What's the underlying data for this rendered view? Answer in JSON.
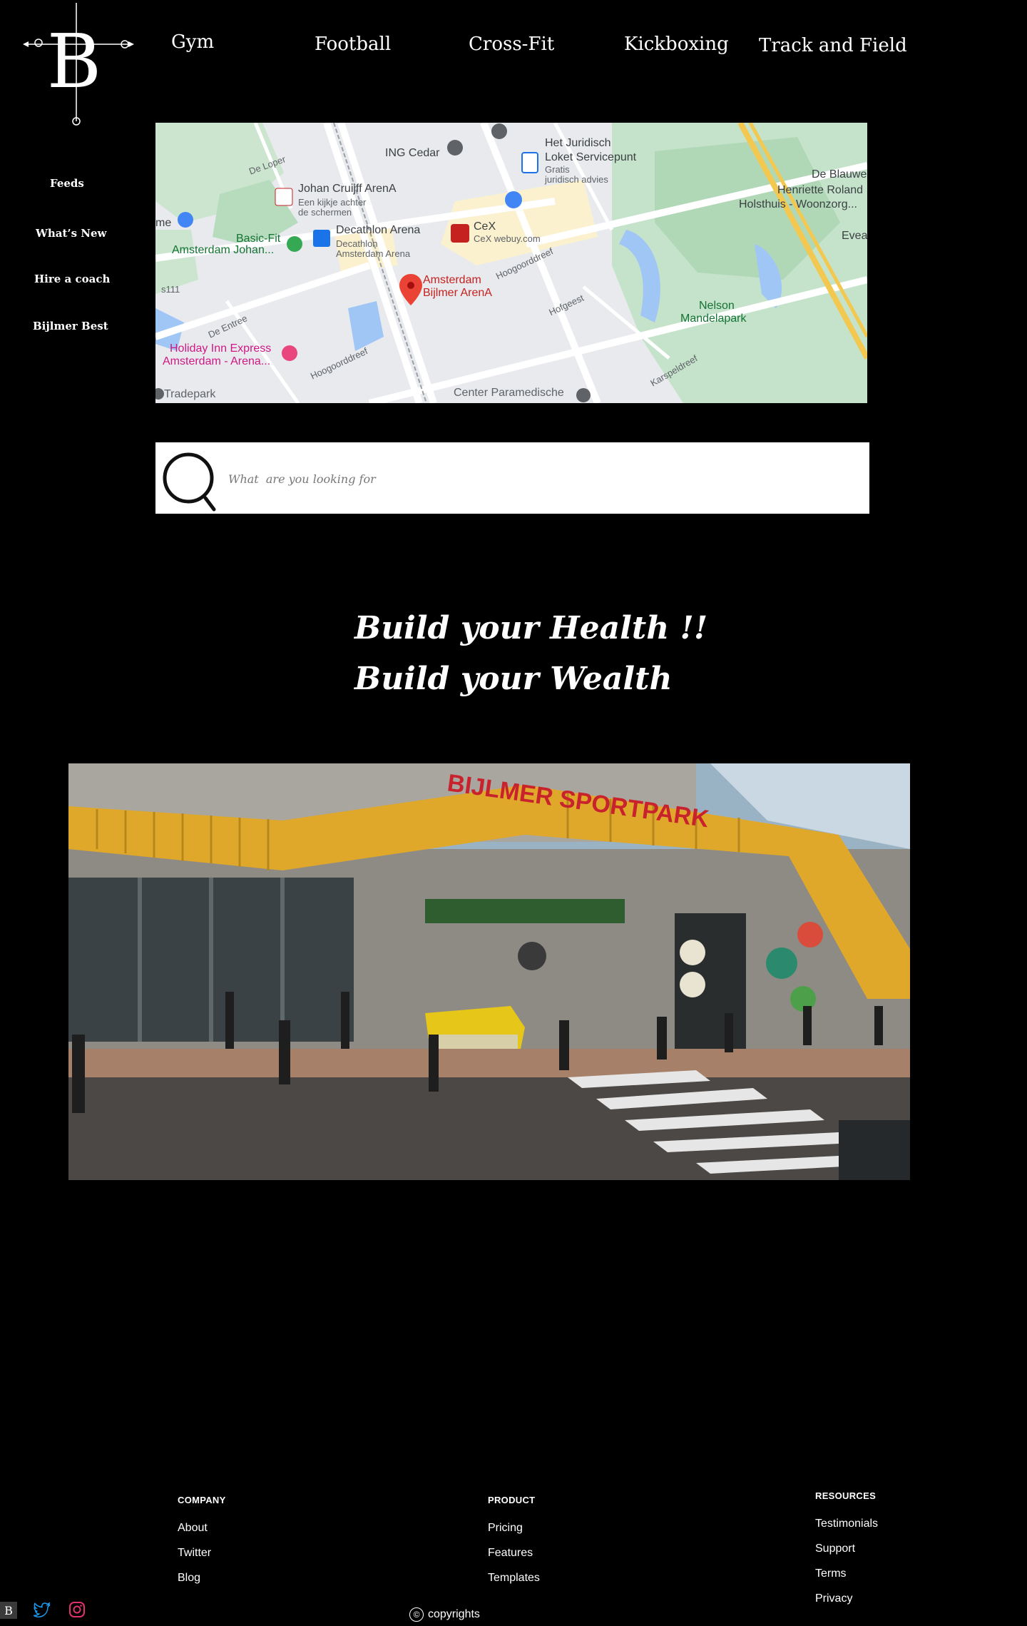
{
  "brand": {
    "logo_letter": "B"
  },
  "top_nav": [
    "Gym",
    "Football",
    "Cross-Fit",
    "Kickboxing",
    "Track and Field"
  ],
  "side_nav": [
    "Feeds",
    "What’s New",
    "Hire a coach",
    "Bijlmer Best"
  ],
  "map": {
    "labels": {
      "ing": "ING Cedar",
      "juridisch1": "Het Juridisch",
      "juridisch2": "Loket Servicepunt",
      "juridisch3": "Gratis",
      "juridisch4": "juridisch advies",
      "blauwe": "De Blauwe",
      "henriette": "Henriette Roland",
      "holsthuis": "Holsthuis - Woonzorg...",
      "evea": "Evea",
      "johan1": "Johan Cruijff ArenA",
      "johan2": "Een kijkje achter",
      "johan3": "de schermen",
      "decathlon1": "Decathlon Arena",
      "decathlon2": "Decathlon",
      "decathlon3": "Amsterdam Arena",
      "basicfit1": "Basic-Fit",
      "basicfit2": "Amsterdam Johan...",
      "cex1": "CeX",
      "cex2": "CeX webuy.com",
      "arena1": "Amsterdam",
      "arena2": "Bijlmer ArenA",
      "nelson1": "Nelson",
      "nelson2": "Mandelapark",
      "holiday1": "Holiday Inn Express",
      "holiday2": "Amsterdam - Arena...",
      "tradepark": "Tradepark",
      "paramedische": "Center Paramedische",
      "me": "me",
      "s111": "s111",
      "de_loper": "De Loper",
      "de_entree": "De Entree",
      "hoogoord1": "Hoogoorddreef",
      "hoogoord2": "Hoogoorddreef",
      "hofgeest": "Hofgeest",
      "karspeldreef": "Karspeldreef"
    }
  },
  "search": {
    "placeholder": "What  are you looking for"
  },
  "hero": {
    "line1": "Build your Health !!",
    "line2": "Build your Wealth"
  },
  "photo": {
    "sign_text": "BIJLMER SPORTPARK"
  },
  "footer": {
    "company": {
      "heading": "COMPANY",
      "links": [
        "About",
        "Twitter",
        "Blog"
      ]
    },
    "product": {
      "heading": "PRODUCT",
      "links": [
        "Pricing",
        "Features",
        "Templates"
      ]
    },
    "resources": {
      "heading": "RESOURCES",
      "links": [
        "Testimonials",
        "Support",
        "Terms",
        "Privacy"
      ]
    },
    "copyright": "copyrights",
    "copyright_symbol": "©"
  },
  "social_icons": [
    "brand-icon",
    "twitter-icon",
    "instagram-icon"
  ],
  "colors": {
    "background": "#000000",
    "text": "#ffffff",
    "twitter": "#1d9bf0",
    "instagram": "#e1306c",
    "map_pin": "#ea4335",
    "sign": "#c8232c",
    "awning": "#e0a82a"
  }
}
